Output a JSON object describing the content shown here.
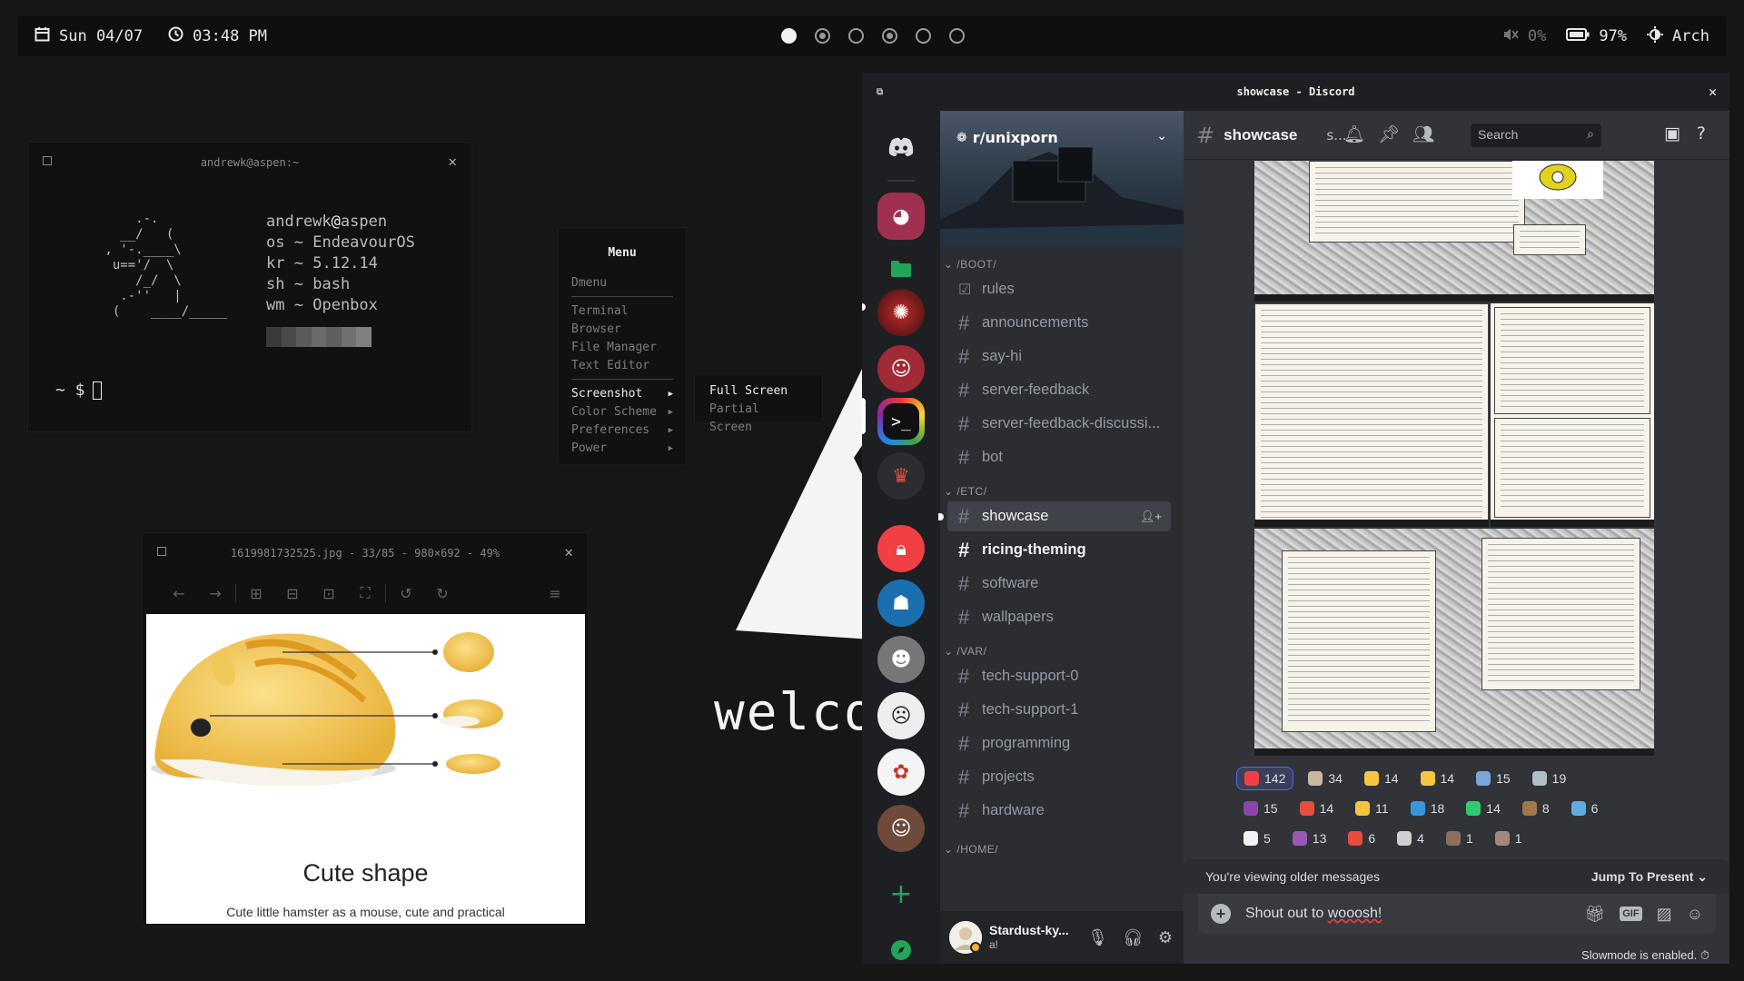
{
  "topbar": {
    "date": "Sun 04/07",
    "time": "03:48 PM",
    "volume": "0%",
    "battery": "97%",
    "distro": "Arch",
    "workspaces": [
      "active",
      "filled",
      "empty",
      "filled",
      "empty",
      "empty"
    ]
  },
  "terminal": {
    "title": "andrewk@aspen:~",
    "ascii_art": "     .-.\n   __/   (\n , '-.____\\\n  u=='/  \\\n     /_/  \\\n   .-''   |\n  (    ____/_____",
    "user": "andrewk",
    "host": "aspen",
    "info": [
      {
        "key": "os",
        "val": "EndeavourOS"
      },
      {
        "key": "kr",
        "val": "5.12.14"
      },
      {
        "key": "sh",
        "val": "bash"
      },
      {
        "key": "wm",
        "val": "Openbox"
      }
    ],
    "sep": "~",
    "palette": [
      "#3a3a3a",
      "#4a4a4a",
      "#5a5a5a",
      "#6a6a6a",
      "#5f5f5f",
      "#707070",
      "#808080"
    ],
    "prompt": "~ $"
  },
  "menu": {
    "title": "Menu",
    "top_item": "Dmenu",
    "items": [
      "Terminal",
      "Browser",
      "File Manager",
      "Text Editor"
    ],
    "sub_items": [
      "Screenshot",
      "Color Scheme",
      "Preferences",
      "Power"
    ],
    "screenshot_submenu": [
      "Full Screen",
      "Partial Screen"
    ]
  },
  "viewer": {
    "title": "1619981732525.jpg - 33/85 - 980×692 - 49%",
    "caption_title": "Cute shape",
    "caption_sub": "Cute little hamster as a mouse, cute and practical"
  },
  "desktop": {
    "welcome": "welcome"
  },
  "discord": {
    "title": "showcase - Discord",
    "server_name": "r/unixporn",
    "categories": [
      {
        "name": "/BOOT/",
        "channels": [
          {
            "name": "rules",
            "icon": "rules"
          },
          {
            "name": "announcements"
          },
          {
            "name": "say-hi"
          },
          {
            "name": "server-feedback"
          },
          {
            "name": "server-feedback-discussi..."
          },
          {
            "name": "bot"
          }
        ]
      },
      {
        "name": "/ETC/",
        "channels": [
          {
            "name": "showcase",
            "selected": true
          },
          {
            "name": "ricing-theming",
            "unread": true
          },
          {
            "name": "software"
          },
          {
            "name": "wallpapers"
          }
        ]
      },
      {
        "name": "/VAR/",
        "channels": [
          {
            "name": "tech-support-0"
          },
          {
            "name": "tech-support-1"
          },
          {
            "name": "programming"
          },
          {
            "name": "projects"
          },
          {
            "name": "hardware"
          }
        ]
      },
      {
        "name": "/HOME/",
        "channels": []
      }
    ],
    "user": {
      "name": "Stardust-ky...",
      "status": "a!"
    },
    "channel_header": {
      "name": "showcase",
      "topic": "s...",
      "search": "Search"
    },
    "reactions": [
      [
        {
          "e": "heart",
          "c": "142",
          "me": true,
          "col": "#f23f43"
        },
        {
          "e": "cat",
          "c": "34",
          "col": "#c8b8a0"
        },
        {
          "e": "starstruck",
          "c": "14",
          "col": "#f5c542"
        },
        {
          "e": "flushed",
          "c": "14",
          "col": "#f5c542"
        },
        {
          "e": "arch",
          "c": "15",
          "col": "#7aa6da"
        },
        {
          "e": "page",
          "c": "19",
          "col": "#b0bec5"
        }
      ],
      [
        {
          "e": "purple",
          "c": "15",
          "col": "#8e44ad"
        },
        {
          "e": "100",
          "c": "14",
          "col": "#e74c3c"
        },
        {
          "e": "smirk",
          "c": "11",
          "col": "#f5c542"
        },
        {
          "e": "blueheart",
          "c": "18",
          "col": "#3498db"
        },
        {
          "e": "parrot",
          "c": "14",
          "col": "#2ecc71"
        },
        {
          "e": "monkey",
          "c": "8",
          "col": "#a0784a"
        },
        {
          "e": "sparkle",
          "c": "6",
          "col": "#5dade2"
        }
      ],
      [
        {
          "e": "whiteheart",
          "c": "5",
          "col": "#f2f2f2"
        },
        {
          "e": "rainbow",
          "c": "13",
          "col": "#9b59b6"
        },
        {
          "e": "this",
          "c": "6",
          "col": "#e74c3c"
        },
        {
          "e": "person",
          "c": "4",
          "col": "#d0d0d0"
        },
        {
          "e": "bird",
          "c": "1",
          "col": "#8d6e63"
        },
        {
          "e": "fox",
          "c": "1",
          "col": "#a1887f"
        }
      ]
    ],
    "older_notice": "You're viewing older messages",
    "jump": "Jump To Present",
    "composer_text_plain": "Shout out to ",
    "composer_text_flagged": "wooosh!",
    "slowmode": "Slowmode is enabled."
  }
}
